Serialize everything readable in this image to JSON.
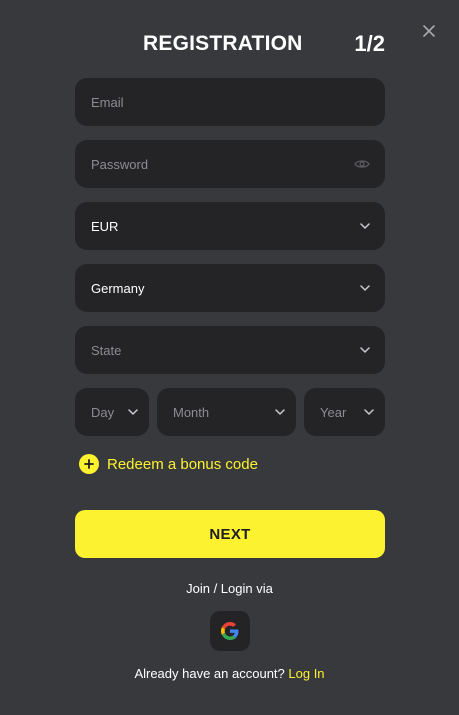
{
  "header": {
    "title": "REGISTRATION",
    "step": "1/2"
  },
  "form": {
    "email_placeholder": "Email",
    "password_placeholder": "Password",
    "currency_value": "EUR",
    "country_value": "Germany",
    "state_placeholder": "State",
    "day_placeholder": "Day",
    "month_placeholder": "Month",
    "year_placeholder": "Year"
  },
  "bonus": {
    "label": "Redeem a bonus code"
  },
  "actions": {
    "next_label": "NEXT"
  },
  "social": {
    "join_text": "Join / Login via",
    "provider_icon": "google-icon"
  },
  "footer": {
    "account_text": "Already have an account?",
    "login_link": "Log In"
  },
  "colors": {
    "background": "#38393d",
    "field_bg": "#242427",
    "accent": "#fdf22f",
    "placeholder": "#8c8c92",
    "text": "#ffffff"
  }
}
